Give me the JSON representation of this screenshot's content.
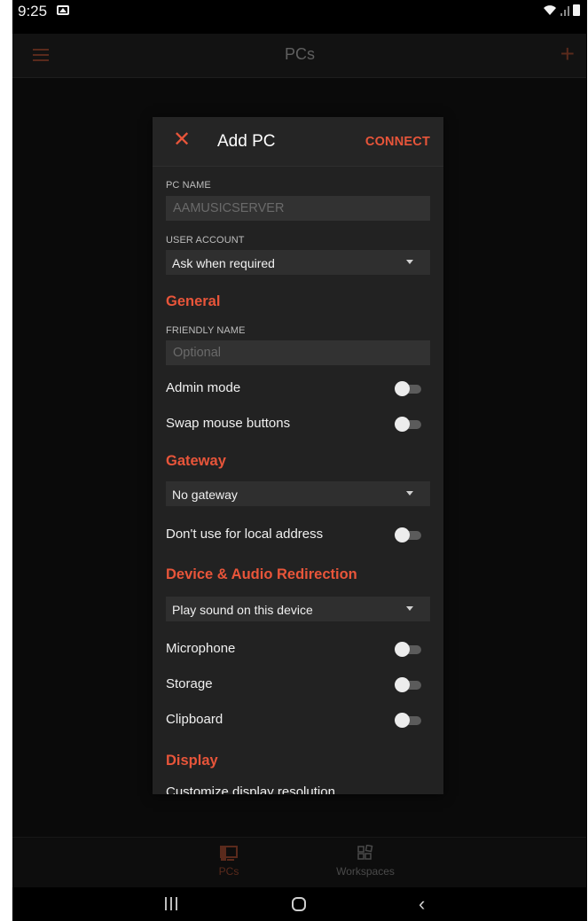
{
  "status_bar": {
    "time": "9:25"
  },
  "app_bar": {
    "title": "PCs"
  },
  "dialog": {
    "close_label": "✕",
    "title": "Add PC",
    "connect_label": "CONNECT",
    "pc_name": {
      "label": "PC NAME",
      "value": "AAMUSICSERVER"
    },
    "user_account": {
      "label": "USER ACCOUNT",
      "value": "Ask when required"
    },
    "general": {
      "title": "General",
      "friendly_name": {
        "label": "FRIENDLY NAME",
        "placeholder": "Optional"
      },
      "admin_mode": "Admin mode",
      "swap_mouse": "Swap mouse buttons"
    },
    "gateway": {
      "title": "Gateway",
      "value": "No gateway",
      "local_address": "Don't use for local address"
    },
    "device_audio": {
      "title": "Device & Audio Redirection",
      "sound_value": "Play sound on this device",
      "microphone": "Microphone",
      "storage": "Storage",
      "clipboard": "Clipboard"
    },
    "display": {
      "title": "Display",
      "customize": "Customize display resolution"
    }
  },
  "bottom_nav": {
    "pcs": "PCs",
    "workspaces": "Workspaces"
  },
  "colors": {
    "accent": "#e8553a",
    "dim_accent": "#5a2a1c",
    "dialog_bg": "#222222"
  }
}
